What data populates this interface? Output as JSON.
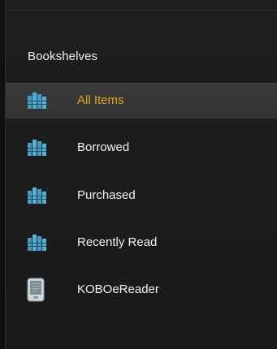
{
  "sidebar": {
    "title": "Bookshelves",
    "items": [
      {
        "label": "All Items",
        "icon": "bookshelf-icon",
        "selected": true
      },
      {
        "label": "Borrowed",
        "icon": "bookshelf-icon",
        "selected": false
      },
      {
        "label": "Purchased",
        "icon": "bookshelf-icon",
        "selected": false
      },
      {
        "label": "Recently Read",
        "icon": "bookshelf-icon",
        "selected": false
      },
      {
        "label": "KOBOeReader",
        "icon": "ereader-device-icon",
        "selected": false
      }
    ]
  },
  "colors": {
    "selected_text": "#e0a21e",
    "text": "#f2f2f2",
    "icon_blue": "#3f9fc7"
  }
}
